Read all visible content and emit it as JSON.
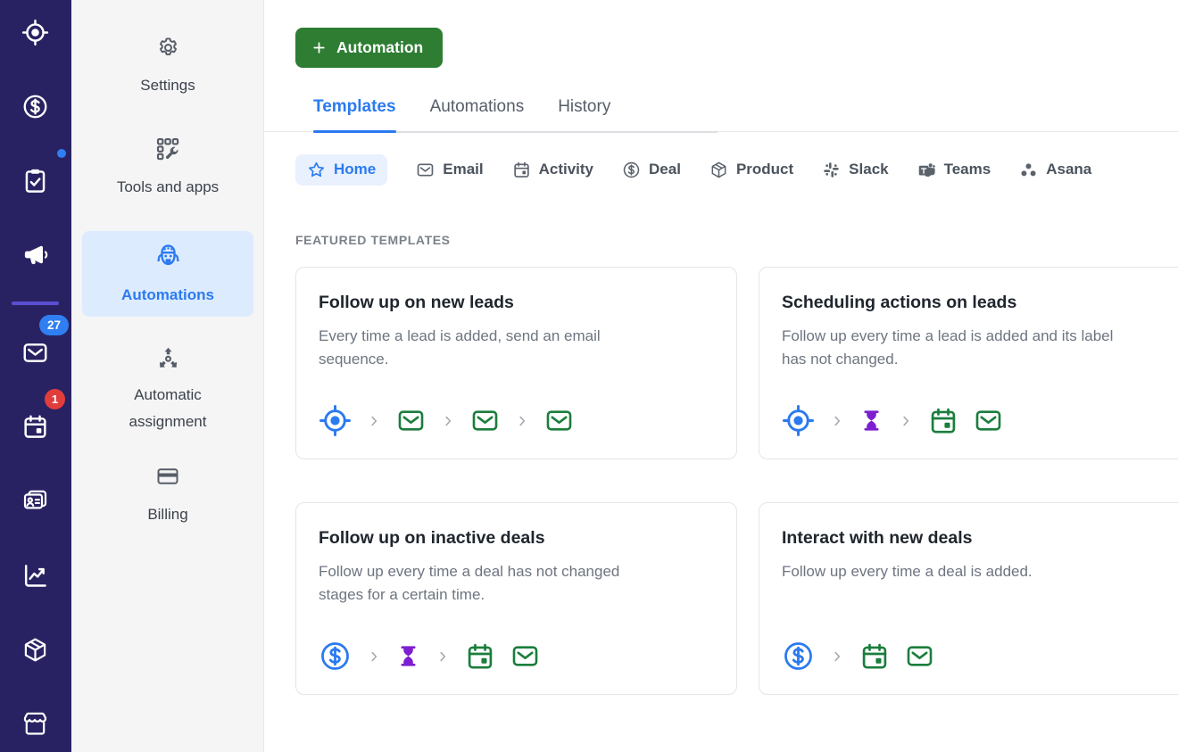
{
  "colors": {
    "accent_blue": "#2b7af0",
    "button_green": "#2e7d33",
    "flow_green": "#1b7e3d",
    "flow_purple": "#7c1fd1",
    "rail_navy": "#292262",
    "badge_blue": "#2f7ff2",
    "badge_red": "#e23d3d",
    "active_item_bg": "#dcebfd"
  },
  "rail": {
    "items": [
      {
        "name": "leads",
        "icon": "crosshair-target-icon"
      },
      {
        "name": "deals",
        "icon": "currency-dollar-icon"
      },
      {
        "name": "tasks",
        "icon": "clipboard-check-icon",
        "dot": true
      },
      {
        "name": "campaigns",
        "icon": "megaphone-icon"
      },
      {
        "name": "mail",
        "icon": "envelope-icon",
        "badge": "27",
        "badge_color": "#2f7ff2",
        "badge_shape": "pill"
      },
      {
        "name": "activities",
        "icon": "calendar-icon",
        "badge": "1",
        "badge_color": "#e23d3d",
        "badge_shape": "round"
      },
      {
        "name": "contacts",
        "icon": "contact-card-icon"
      },
      {
        "name": "insights",
        "icon": "line-chart-icon"
      },
      {
        "name": "products",
        "icon": "package-box-icon"
      },
      {
        "name": "marketplace",
        "icon": "storefront-icon"
      }
    ]
  },
  "sidebar": {
    "items": [
      {
        "label": "Settings",
        "icon": "gear-icon"
      },
      {
        "label": "Tools and apps",
        "icon": "tools-apps-icon"
      },
      {
        "label": "Automations",
        "icon": "robot-icon",
        "active": true
      },
      {
        "label": "Automatic assignment",
        "icon": "distribute-arrows-icon"
      },
      {
        "label": "Billing",
        "icon": "credit-card-icon"
      }
    ]
  },
  "toolbar": {
    "new_automation_label": "Automation"
  },
  "tabs": [
    {
      "label": "Templates",
      "active": true
    },
    {
      "label": "Automations"
    },
    {
      "label": "History"
    }
  ],
  "filters": [
    {
      "label": "Home",
      "icon": "star-icon",
      "active": true
    },
    {
      "label": "Email",
      "icon": "envelope-icon"
    },
    {
      "label": "Activity",
      "icon": "calendar-icon"
    },
    {
      "label": "Deal",
      "icon": "currency-dollar-icon"
    },
    {
      "label": "Product",
      "icon": "package-box-icon"
    },
    {
      "label": "Slack",
      "icon": "slack-icon"
    },
    {
      "label": "Teams",
      "icon": "teams-icon"
    },
    {
      "label": "Asana",
      "icon": "asana-icon"
    }
  ],
  "section": {
    "title": "FEATURED TEMPLATES"
  },
  "cards": [
    {
      "title": "Follow up on new leads",
      "description": "Every time a lead is added, send an email sequence.",
      "flow": [
        "lead-trigger-icon",
        "chevron-right-icon",
        "send-email-icon",
        "chevron-right-icon",
        "send-email-icon",
        "chevron-right-icon",
        "send-email-icon"
      ]
    },
    {
      "title": "Scheduling actions on leads",
      "description": "Follow up every time a lead is added and its label has not changed.",
      "flow": [
        "lead-trigger-icon",
        "chevron-right-icon",
        "wait-hourglass-icon",
        "chevron-right-icon",
        "schedule-activity-icon",
        "send-email-icon"
      ]
    },
    {
      "title": "Follow up on inactive deals",
      "description": "Follow up every time a deal has not changed stages for a certain time.",
      "flow": [
        "deal-trigger-icon",
        "chevron-right-icon",
        "wait-hourglass-icon",
        "chevron-right-icon",
        "schedule-activity-icon",
        "send-email-icon"
      ]
    },
    {
      "title": "Interact with new deals",
      "description": "Follow up every time a deal is added.",
      "flow": [
        "deal-trigger-icon",
        "chevron-right-icon",
        "schedule-activity-icon",
        "send-email-icon"
      ]
    }
  ]
}
